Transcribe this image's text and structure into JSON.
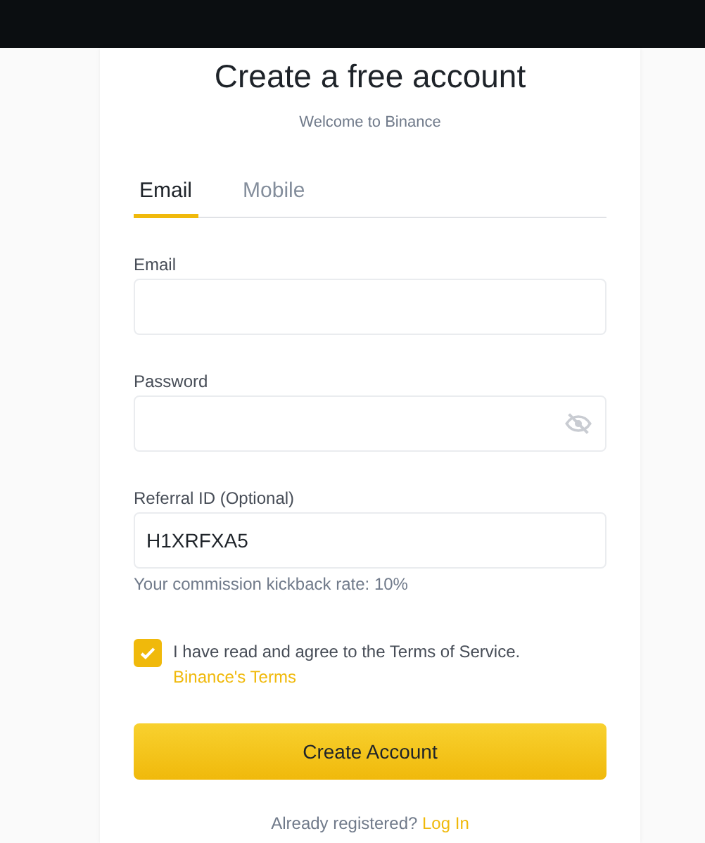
{
  "title": "Create a free account",
  "subtitle": "Welcome to Binance",
  "tabs": [
    {
      "label": "Email",
      "selected": true
    },
    {
      "label": "Mobile",
      "selected": false
    }
  ],
  "fields": [
    {
      "label": "Email",
      "kind": "text"
    },
    {
      "label": "Password",
      "kind": "password"
    },
    {
      "label": "Referral ID (Optional)",
      "kind": "text",
      "value": "H1XRFXA5",
      "hint": "Your commission kickback rate: 10%"
    }
  ],
  "agreement": {
    "checked": true,
    "text": "I have read and agree to the Terms of Service.",
    "link": "Binance's Terms"
  },
  "submit": "Create Account",
  "footer": {
    "text": "Already registered?",
    "link": "Log In"
  }
}
